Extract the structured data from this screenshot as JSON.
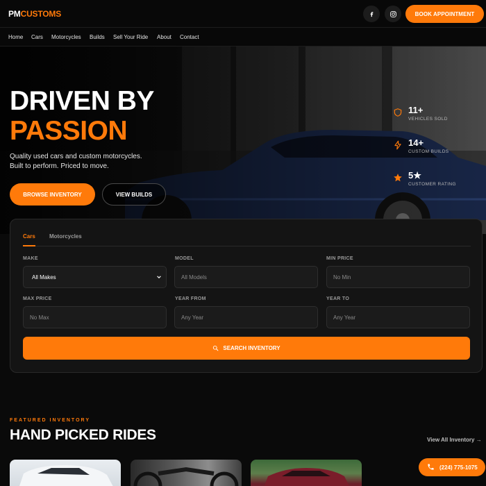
{
  "brand": {
    "part1": "PM",
    "part2": "CUSTOMS"
  },
  "header": {
    "book_label": "BOOK APPOINTMENT",
    "social": [
      "facebook-icon",
      "instagram-icon"
    ]
  },
  "nav": [
    "Home",
    "Cars",
    "Motorcycles",
    "Builds",
    "Sell Your Ride",
    "About",
    "Contact"
  ],
  "hero": {
    "line1": "DRIVEN BY",
    "line2": "PASSION",
    "sub1": "Quality used cars and custom motorcycles.",
    "sub2": "Built to perform. Priced to move.",
    "primary_label": "BROWSE INVENTORY",
    "secondary_label": "VIEW BUILDS",
    "stats": [
      {
        "value": "11+",
        "label": "VEHICLES SOLD",
        "icon": "shield-icon"
      },
      {
        "value": "14+",
        "label": "CUSTOM BUILDS",
        "icon": "bolt-icon"
      },
      {
        "value": "5★",
        "label": "CUSTOMER RATING",
        "icon": "star-icon"
      }
    ]
  },
  "search": {
    "tabs": [
      "Cars",
      "Motorcycles"
    ],
    "active_tab": "Cars",
    "fields": {
      "make": {
        "label": "MAKE",
        "value": "All Makes"
      },
      "model": {
        "label": "MODEL",
        "placeholder": "All Models"
      },
      "min_price": {
        "label": "MIN PRICE",
        "placeholder": "No Min"
      },
      "max_price": {
        "label": "MAX PRICE",
        "placeholder": "No Max"
      },
      "year_from": {
        "label": "YEAR FROM",
        "placeholder": "Any Year"
      },
      "year_to": {
        "label": "YEAR TO",
        "placeholder": "Any Year"
      }
    },
    "button_label": "SEARCH INVENTORY"
  },
  "featured": {
    "eyebrow": "FEATURED INVENTORY",
    "title": "HAND PICKED RIDES",
    "view_all": "View All Inventory →"
  },
  "phone": "(224) 775-1075",
  "colors": {
    "accent": "#ff7a0a",
    "background": "#0a0a0a"
  }
}
